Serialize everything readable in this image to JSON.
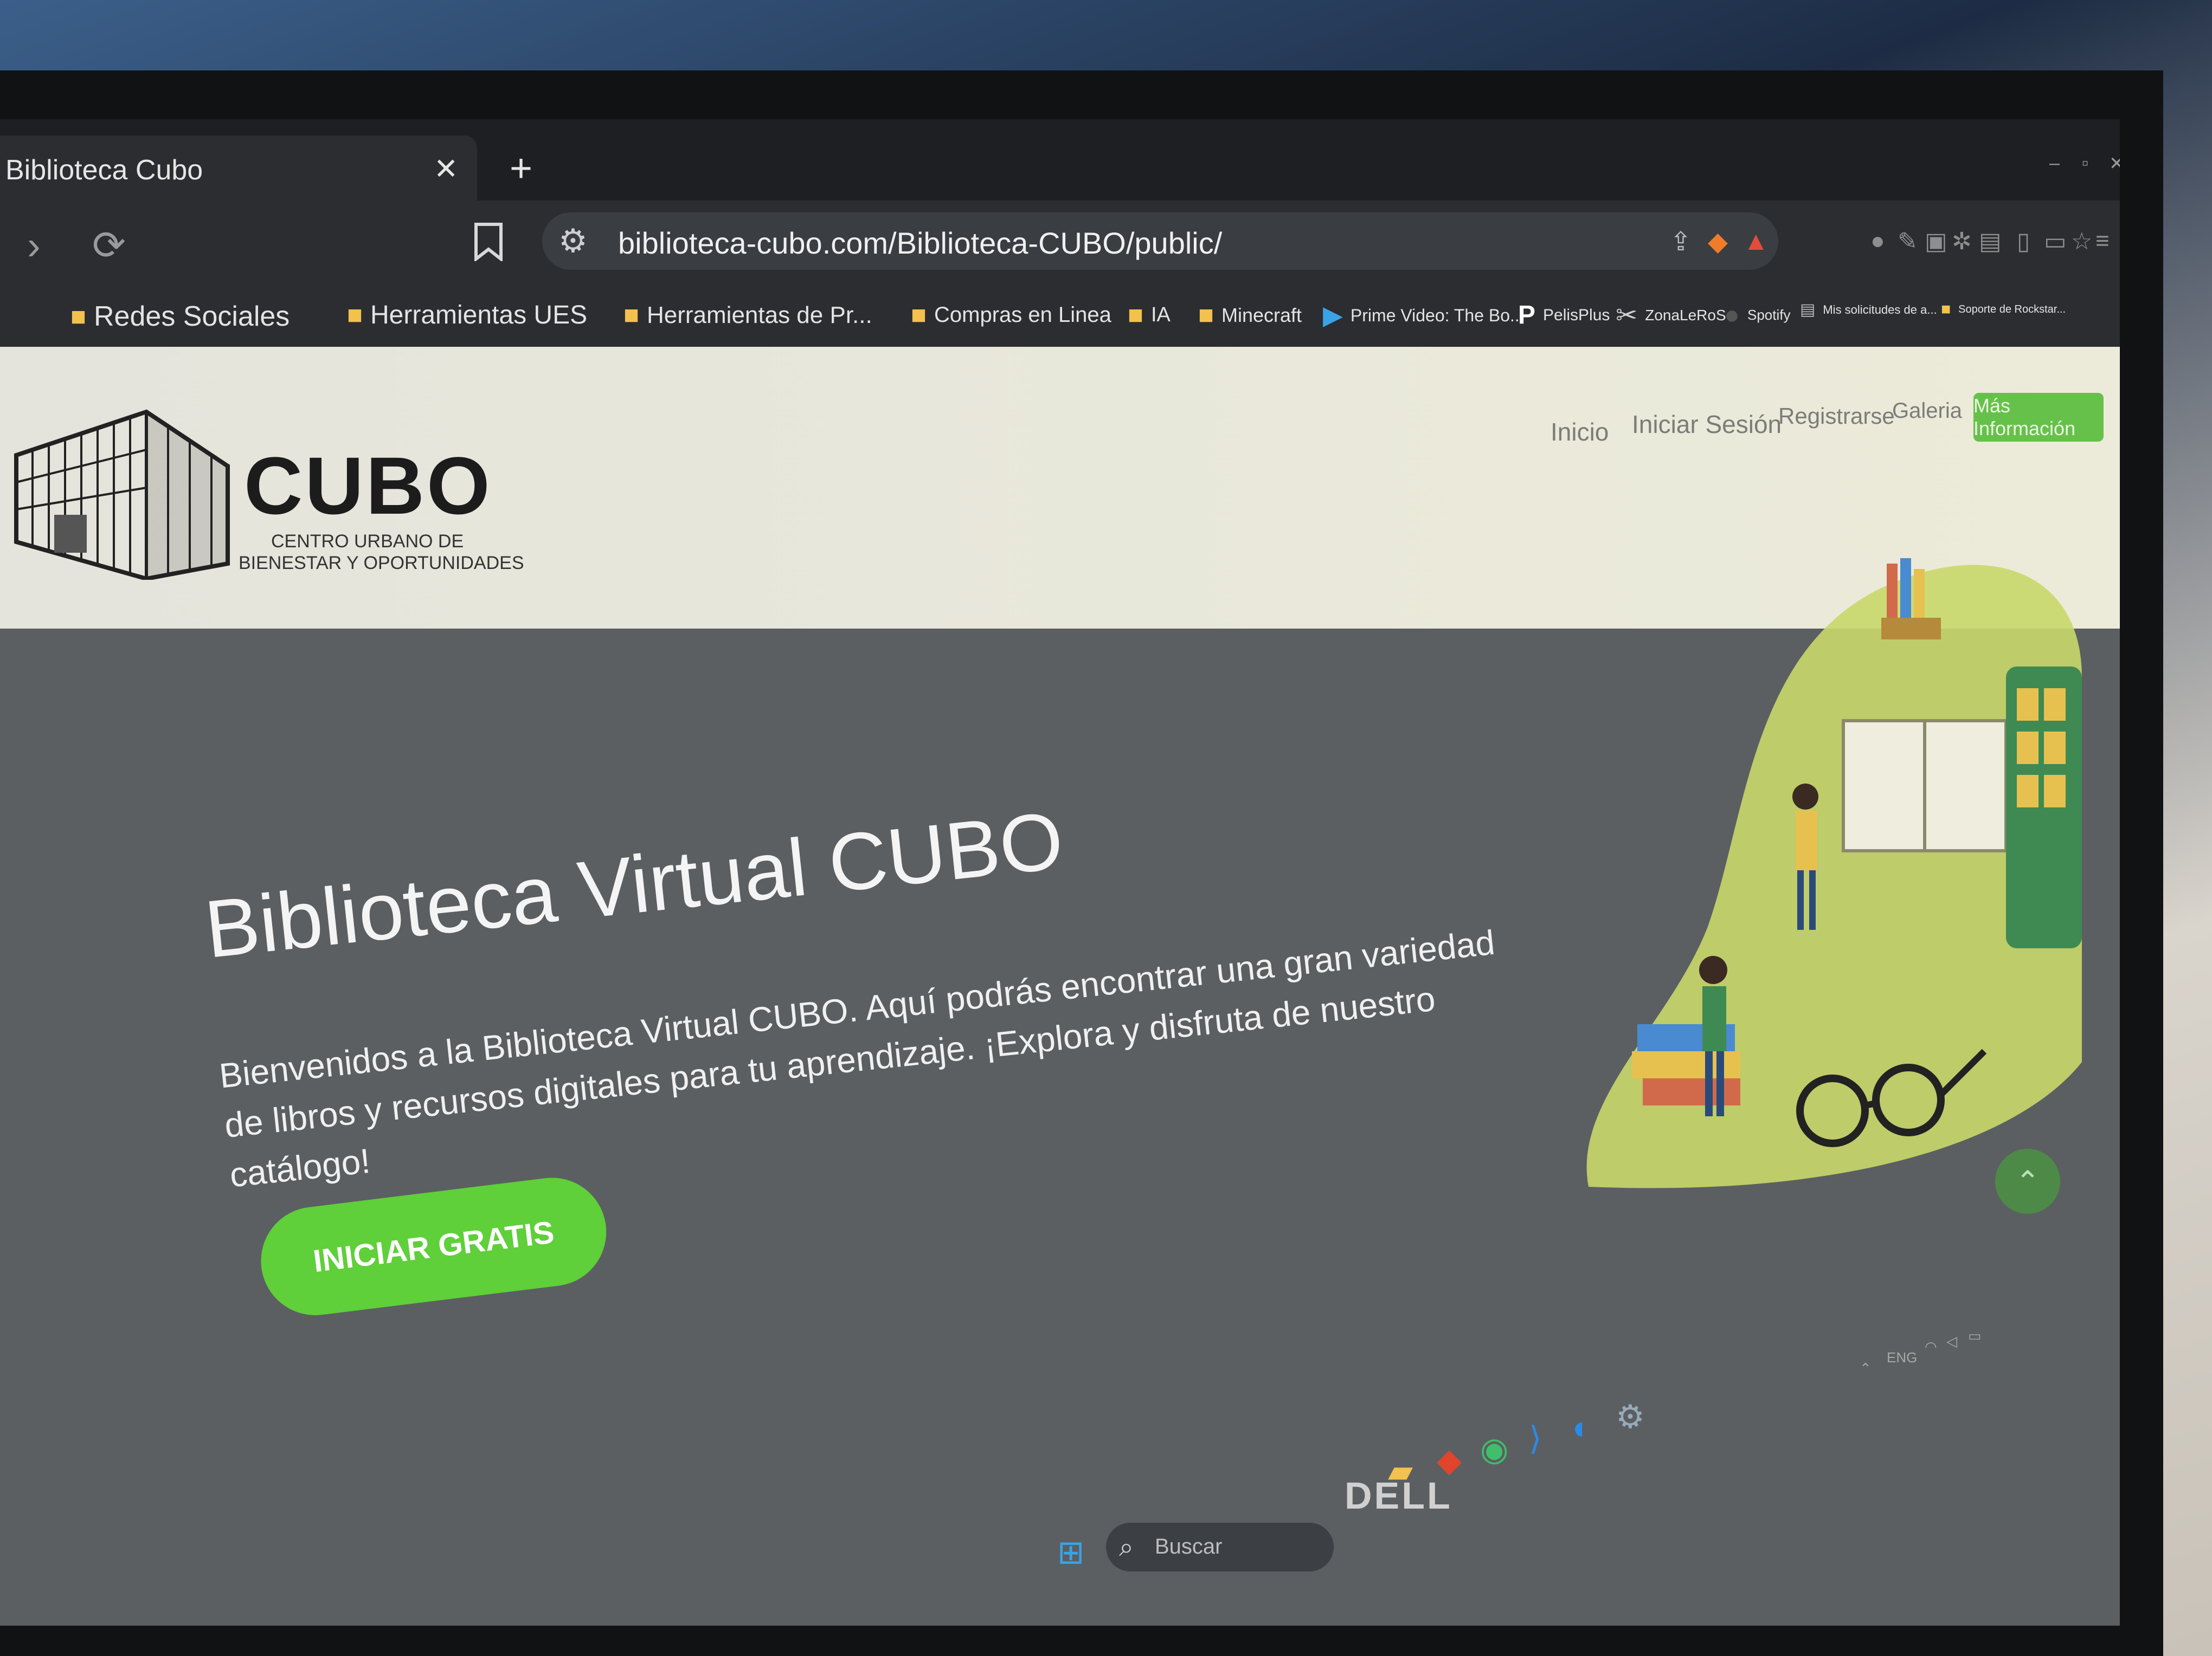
{
  "browser": {
    "tab_title": "Biblioteca Cubo",
    "tab_close": "✕",
    "new_tab": "+",
    "url": "biblioteca-cubo.com/Biblioteca-CUBO/public/",
    "bookmarks": [
      {
        "label": "Redes Sociales",
        "icon": "folder-icon"
      },
      {
        "label": "Herramientas UES",
        "icon": "folder-icon"
      },
      {
        "label": "Herramientas de Pr...",
        "icon": "folder-icon"
      },
      {
        "label": "Compras en Linea",
        "icon": "folder-icon"
      },
      {
        "label": "IA",
        "icon": "folder-icon"
      },
      {
        "label": "Minecraft",
        "icon": "folder-icon"
      },
      {
        "label": "Prime Video: The Bo...",
        "icon": "prime-video-icon"
      },
      {
        "label": "PelisPlus",
        "icon": "pelisplus-icon"
      },
      {
        "label": "ZonaLeRoS",
        "icon": "zonaleros-icon"
      },
      {
        "label": "Spotify",
        "icon": "spotify-icon"
      },
      {
        "label": "Mis solicitudes de a...",
        "icon": "page-icon"
      },
      {
        "label": "Soporte de Rockstar...",
        "icon": "rockstar-icon"
      }
    ]
  },
  "site": {
    "logo_title": "CUBO",
    "logo_subtitle_line1": "CENTRO URBANO DE",
    "logo_subtitle_line2": "BIENESTAR Y OPORTUNIDADES",
    "nav": [
      "Inicio",
      "Iniciar Sesión",
      "Registrarse",
      "Galeria"
    ],
    "nav_cta": "Más Información",
    "hero_title": "Biblioteca Virtual CUBO",
    "hero_body": "Bienvenidos a la Biblioteca Virtual CUBO. Aquí podrás encontrar una gran variedad de libros y recursos digitales para tu aprendizaje. ¡Explora y disfruta de nuestro catálogo!",
    "hero_cta": "INICIAR GRATIS"
  },
  "taskbar": {
    "search_placeholder": "Buscar",
    "tray_lang": "ENG"
  },
  "monitor_brand": "DELL",
  "colors": {
    "accent_green": "#5fcf3a",
    "header_bg": "#e8e8dc",
    "hero_bg": "#5b5f62"
  }
}
